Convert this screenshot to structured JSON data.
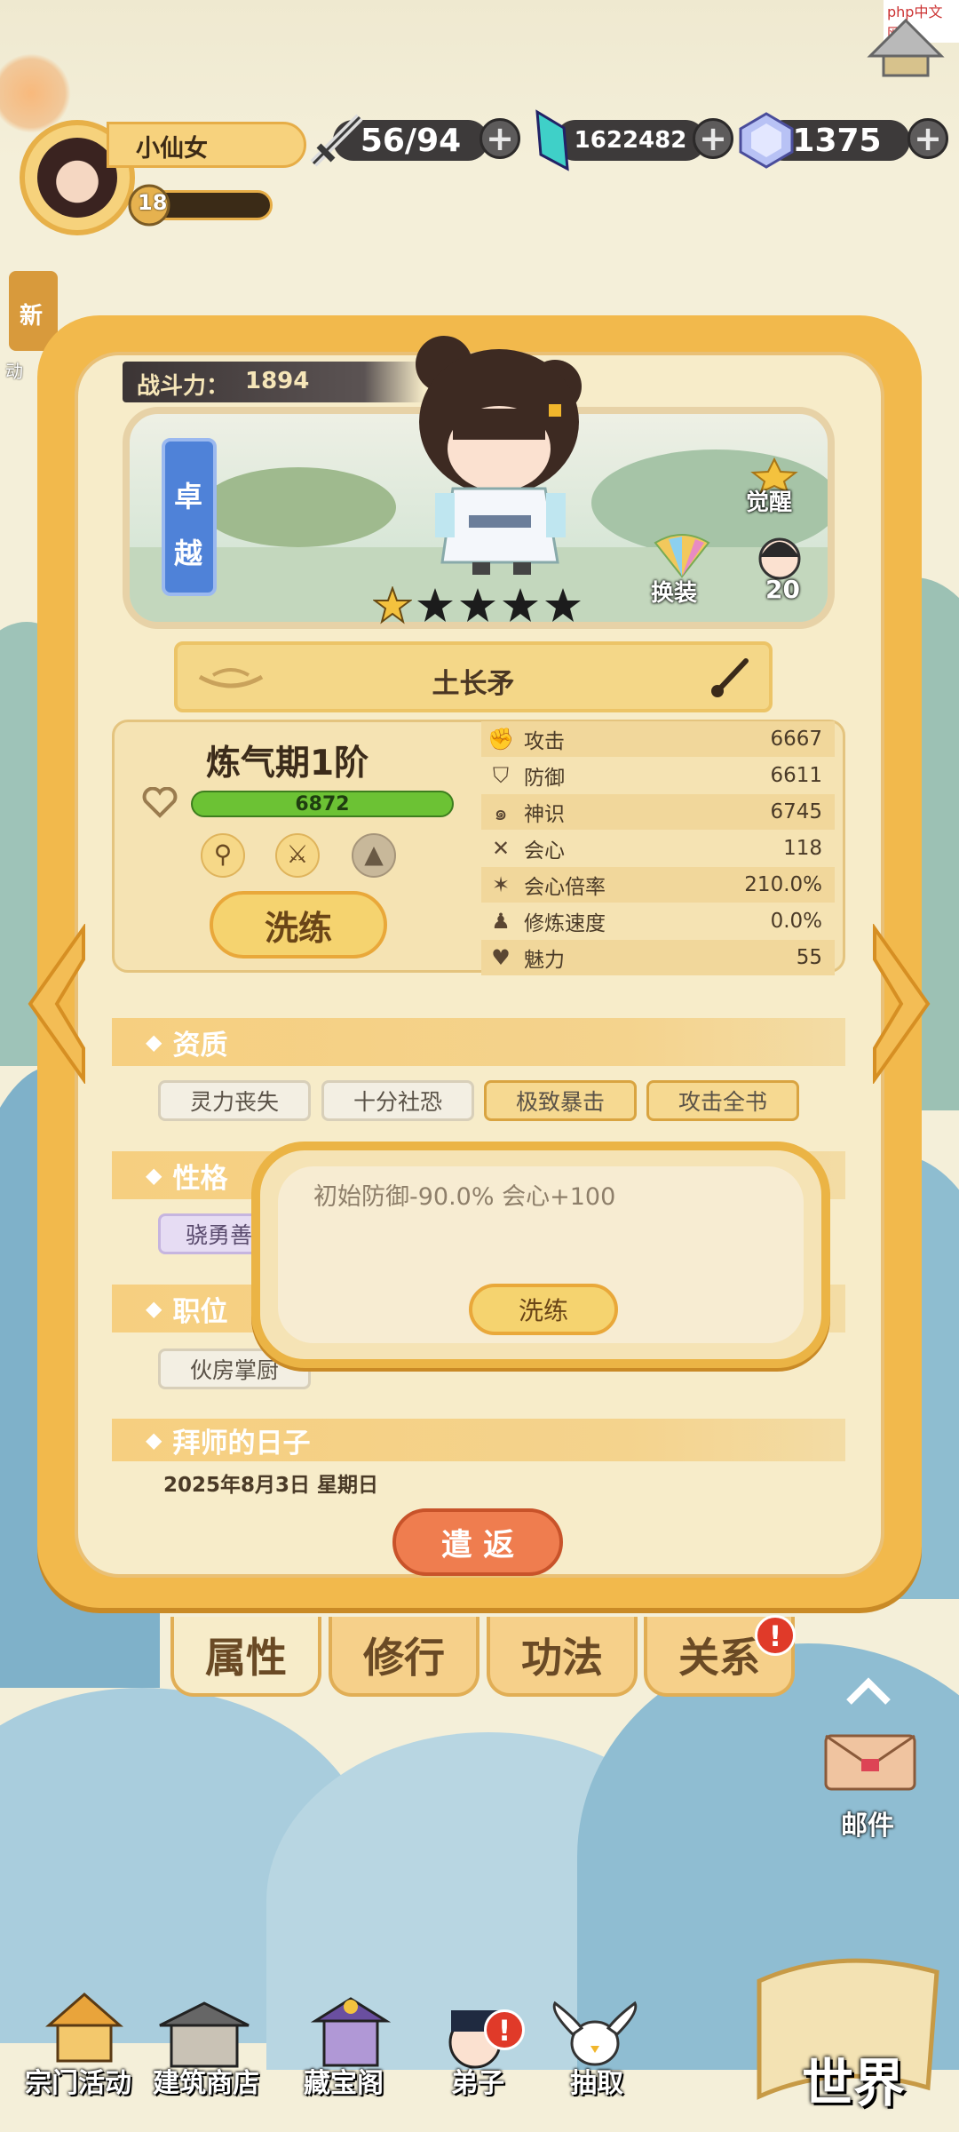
{
  "player": {
    "name": "小仙女",
    "level": "18"
  },
  "resources": {
    "stamina": "56/94",
    "spirit_stones": "1622482",
    "gems": "1375"
  },
  "top_left_badge": "新",
  "top_left_side_text": "动",
  "power": {
    "label": "战斗力：",
    "value": "1894"
  },
  "character": {
    "quality": "卓越",
    "stars_filled": 1,
    "stars_total": 5,
    "awaken_label": "觉醒",
    "dress_label": "换装",
    "count": "20",
    "weapon_name": "土长矛"
  },
  "realm": {
    "name": "炼气期1阶",
    "hp": "6872",
    "wash_button": "洗练"
  },
  "stats": [
    {
      "icon": "fist-icon",
      "label": "攻击",
      "value": "6667"
    },
    {
      "icon": "shield-icon",
      "label": "防御",
      "value": "6611"
    },
    {
      "icon": "spiral-icon",
      "label": "神识",
      "value": "6745"
    },
    {
      "icon": "cross-swords-icon",
      "label": "会心",
      "value": "118"
    },
    {
      "icon": "burst-icon",
      "label": "会心倍率",
      "value": "210.0%"
    },
    {
      "icon": "gourd-icon",
      "label": "修炼速度",
      "value": "0.0%"
    },
    {
      "icon": "heart-icon",
      "label": "魅力",
      "value": "55"
    }
  ],
  "sections": {
    "aptitude": {
      "title": "资质",
      "tags": [
        "灵力丧失",
        "十分社恐",
        "极致暴击",
        "攻击全书"
      ]
    },
    "personality": {
      "title": "性格",
      "tags": [
        "骁勇善"
      ]
    },
    "position": {
      "title": "职位",
      "tags": [
        "伙房掌厨"
      ]
    },
    "apprentice_day": {
      "title": "拜师的日子",
      "date": "2025年8月3日 星期日"
    }
  },
  "popup": {
    "text": "初始防御-90.0% 会心+100",
    "button": "洗练"
  },
  "dismiss_button": "遣 返",
  "tabs": [
    "属性",
    "修行",
    "功法",
    "关系"
  ],
  "mail_label": "邮件",
  "nav": [
    "宗门活动",
    "建筑商店",
    "藏宝阁",
    "弟子",
    "抽取"
  ],
  "world_label": "世界",
  "watermark": "php中文网",
  "colors": {
    "panel": "#f2b94c",
    "panel_inner": "#f7ecc9",
    "accent_red": "#e03a29",
    "hp_green": "#6cc234"
  }
}
